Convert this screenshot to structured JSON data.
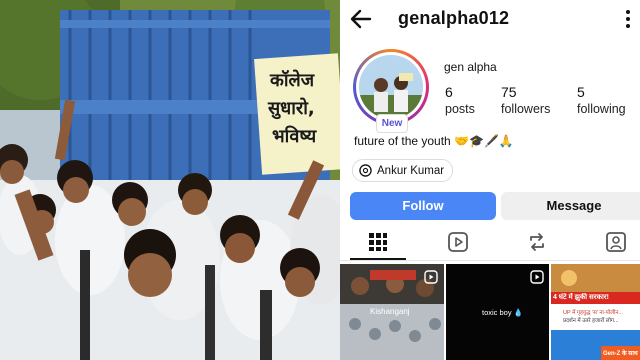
{
  "photo": {
    "sign_lines": [
      "कॉलेज",
      "सुधारो,",
      "भविष्य"
    ]
  },
  "profile": {
    "username": "genalpha012",
    "display_name": "gen alpha",
    "new_badge": "New",
    "stats": {
      "posts": {
        "value": "6",
        "label": "posts"
      },
      "followers": {
        "value": "75",
        "label": "followers"
      },
      "following": {
        "value": "5",
        "label": "following"
      }
    },
    "bio": "future of the youth 🤝🎓🖋️🙏",
    "mention": "Ankur Kumar",
    "follow_label": "Follow",
    "message_label": "Message",
    "tabs": [
      "grid-icon",
      "reels-icon",
      "reposts-icon",
      "tagged-icon"
    ]
  },
  "grid": {
    "thumb2_caption": "toxic boy 💧",
    "thumb3_headline": "4 घंटे में झुकी सरकार!",
    "thumb3_line1": "UP में गृहयुद्ध 'स' ना-पोलीन...",
    "thumb3_line2": "प्रदर्शन में उतरे हजारों लोग...",
    "thumb3_bottom": "Gen-Z के साथ",
    "thumb1_caption": "Kishanganj"
  },
  "colors": {
    "follow_blue": "#4a86f5",
    "message_gray": "#efefef",
    "new_badge_text": "#5b51d8"
  }
}
